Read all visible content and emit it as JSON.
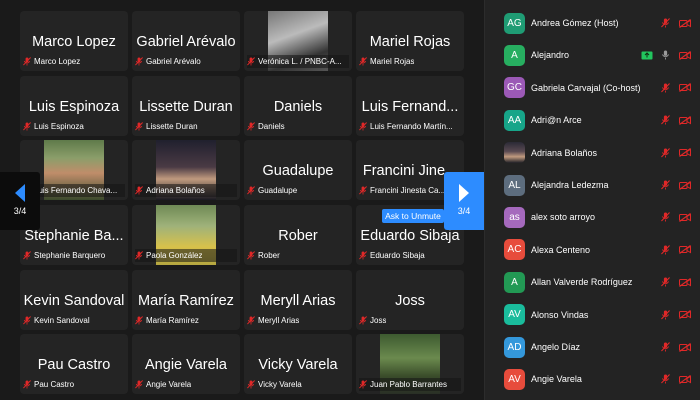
{
  "gallery": {
    "tiles": [
      {
        "big": "Marco Lopez",
        "small": "Marco Lopez"
      },
      {
        "big": "Gabriel Arévalo",
        "small": "Gabriel Arévalo"
      },
      {
        "big": "",
        "small": "Verónica L. / PNBC-A..."
      },
      {
        "big": "Mariel Rojas",
        "small": "Mariel Rojas"
      },
      {
        "big": "Luis Espinoza",
        "small": "Luis Espinoza"
      },
      {
        "big": "Lissette Duran",
        "small": "Lissette Duran"
      },
      {
        "big": "Daniels",
        "small": "Daniels"
      },
      {
        "big": "Luis Fernand...",
        "small": "Luis Fernando Martín..."
      },
      {
        "big": "",
        "small": "Luis Fernando Chava..."
      },
      {
        "big": "",
        "small": "Adriana Bolaños"
      },
      {
        "big": "Guadalupe",
        "small": "Guadalupe"
      },
      {
        "big": "Francini Jine...",
        "small": "Francini Jinesta Ca..."
      },
      {
        "big": "Stephanie Ba...",
        "small": "Stephanie Barquero"
      },
      {
        "big": "",
        "small": "Paola González"
      },
      {
        "big": "Rober",
        "small": "Rober"
      },
      {
        "big": "Eduardo Sibaja",
        "small": "Eduardo Sibaja"
      },
      {
        "big": "Kevin Sandoval",
        "small": "Kevin Sandoval"
      },
      {
        "big": "María Ramírez",
        "small": "María Ramírez"
      },
      {
        "big": "Meryll Arias",
        "small": "Meryll Arias"
      },
      {
        "big": "Joss",
        "small": "Joss"
      },
      {
        "big": "Pau Castro",
        "small": "Pau Castro"
      },
      {
        "big": "Angie Varela",
        "small": "Angie Varela"
      },
      {
        "big": "Vicky Varela",
        "small": "Vicky Varela"
      },
      {
        "big": "",
        "small": "Juan Pablo Barrantes"
      }
    ],
    "page_left": "3/4",
    "page_right": "3/4",
    "ask_to_unmute": "Ask to Unmute"
  },
  "participants": [
    {
      "initials": "AG",
      "name": "Andrea Gómez (Host)",
      "color": "#1f9c74"
    },
    {
      "initials": "A",
      "name": "Alejandro",
      "color": "#27ae60"
    },
    {
      "initials": "GC",
      "name": "Gabriela Carvajal (Co-host)",
      "color": "#9b59b6"
    },
    {
      "initials": "AA",
      "name": "Adri@n Arce",
      "color": "#17a589"
    },
    {
      "initials": "",
      "name": "Adriana Bolaños",
      "color": "#3a3a3a"
    },
    {
      "initials": "AL",
      "name": "Alejandra Ledezma",
      "color": "#5d6d7e"
    },
    {
      "initials": "as",
      "name": "alex soto arroyo",
      "color": "#a569bd"
    },
    {
      "initials": "AC",
      "name": "Alexa Centeno",
      "color": "#e74c3c"
    },
    {
      "initials": "A",
      "name": "Allan Valverde Rodríguez",
      "color": "#229954"
    },
    {
      "initials": "AV",
      "name": "Alonso Vindas",
      "color": "#1abc9c"
    },
    {
      "initials": "AD",
      "name": "Angelo Díaz",
      "color": "#3498db"
    },
    {
      "initials": "AV",
      "name": "Angie Varela",
      "color": "#e74c3c"
    }
  ],
  "colors": {
    "accent": "#2d8cff",
    "muted": "#e02828",
    "unmuted": "#9a9a9a"
  }
}
